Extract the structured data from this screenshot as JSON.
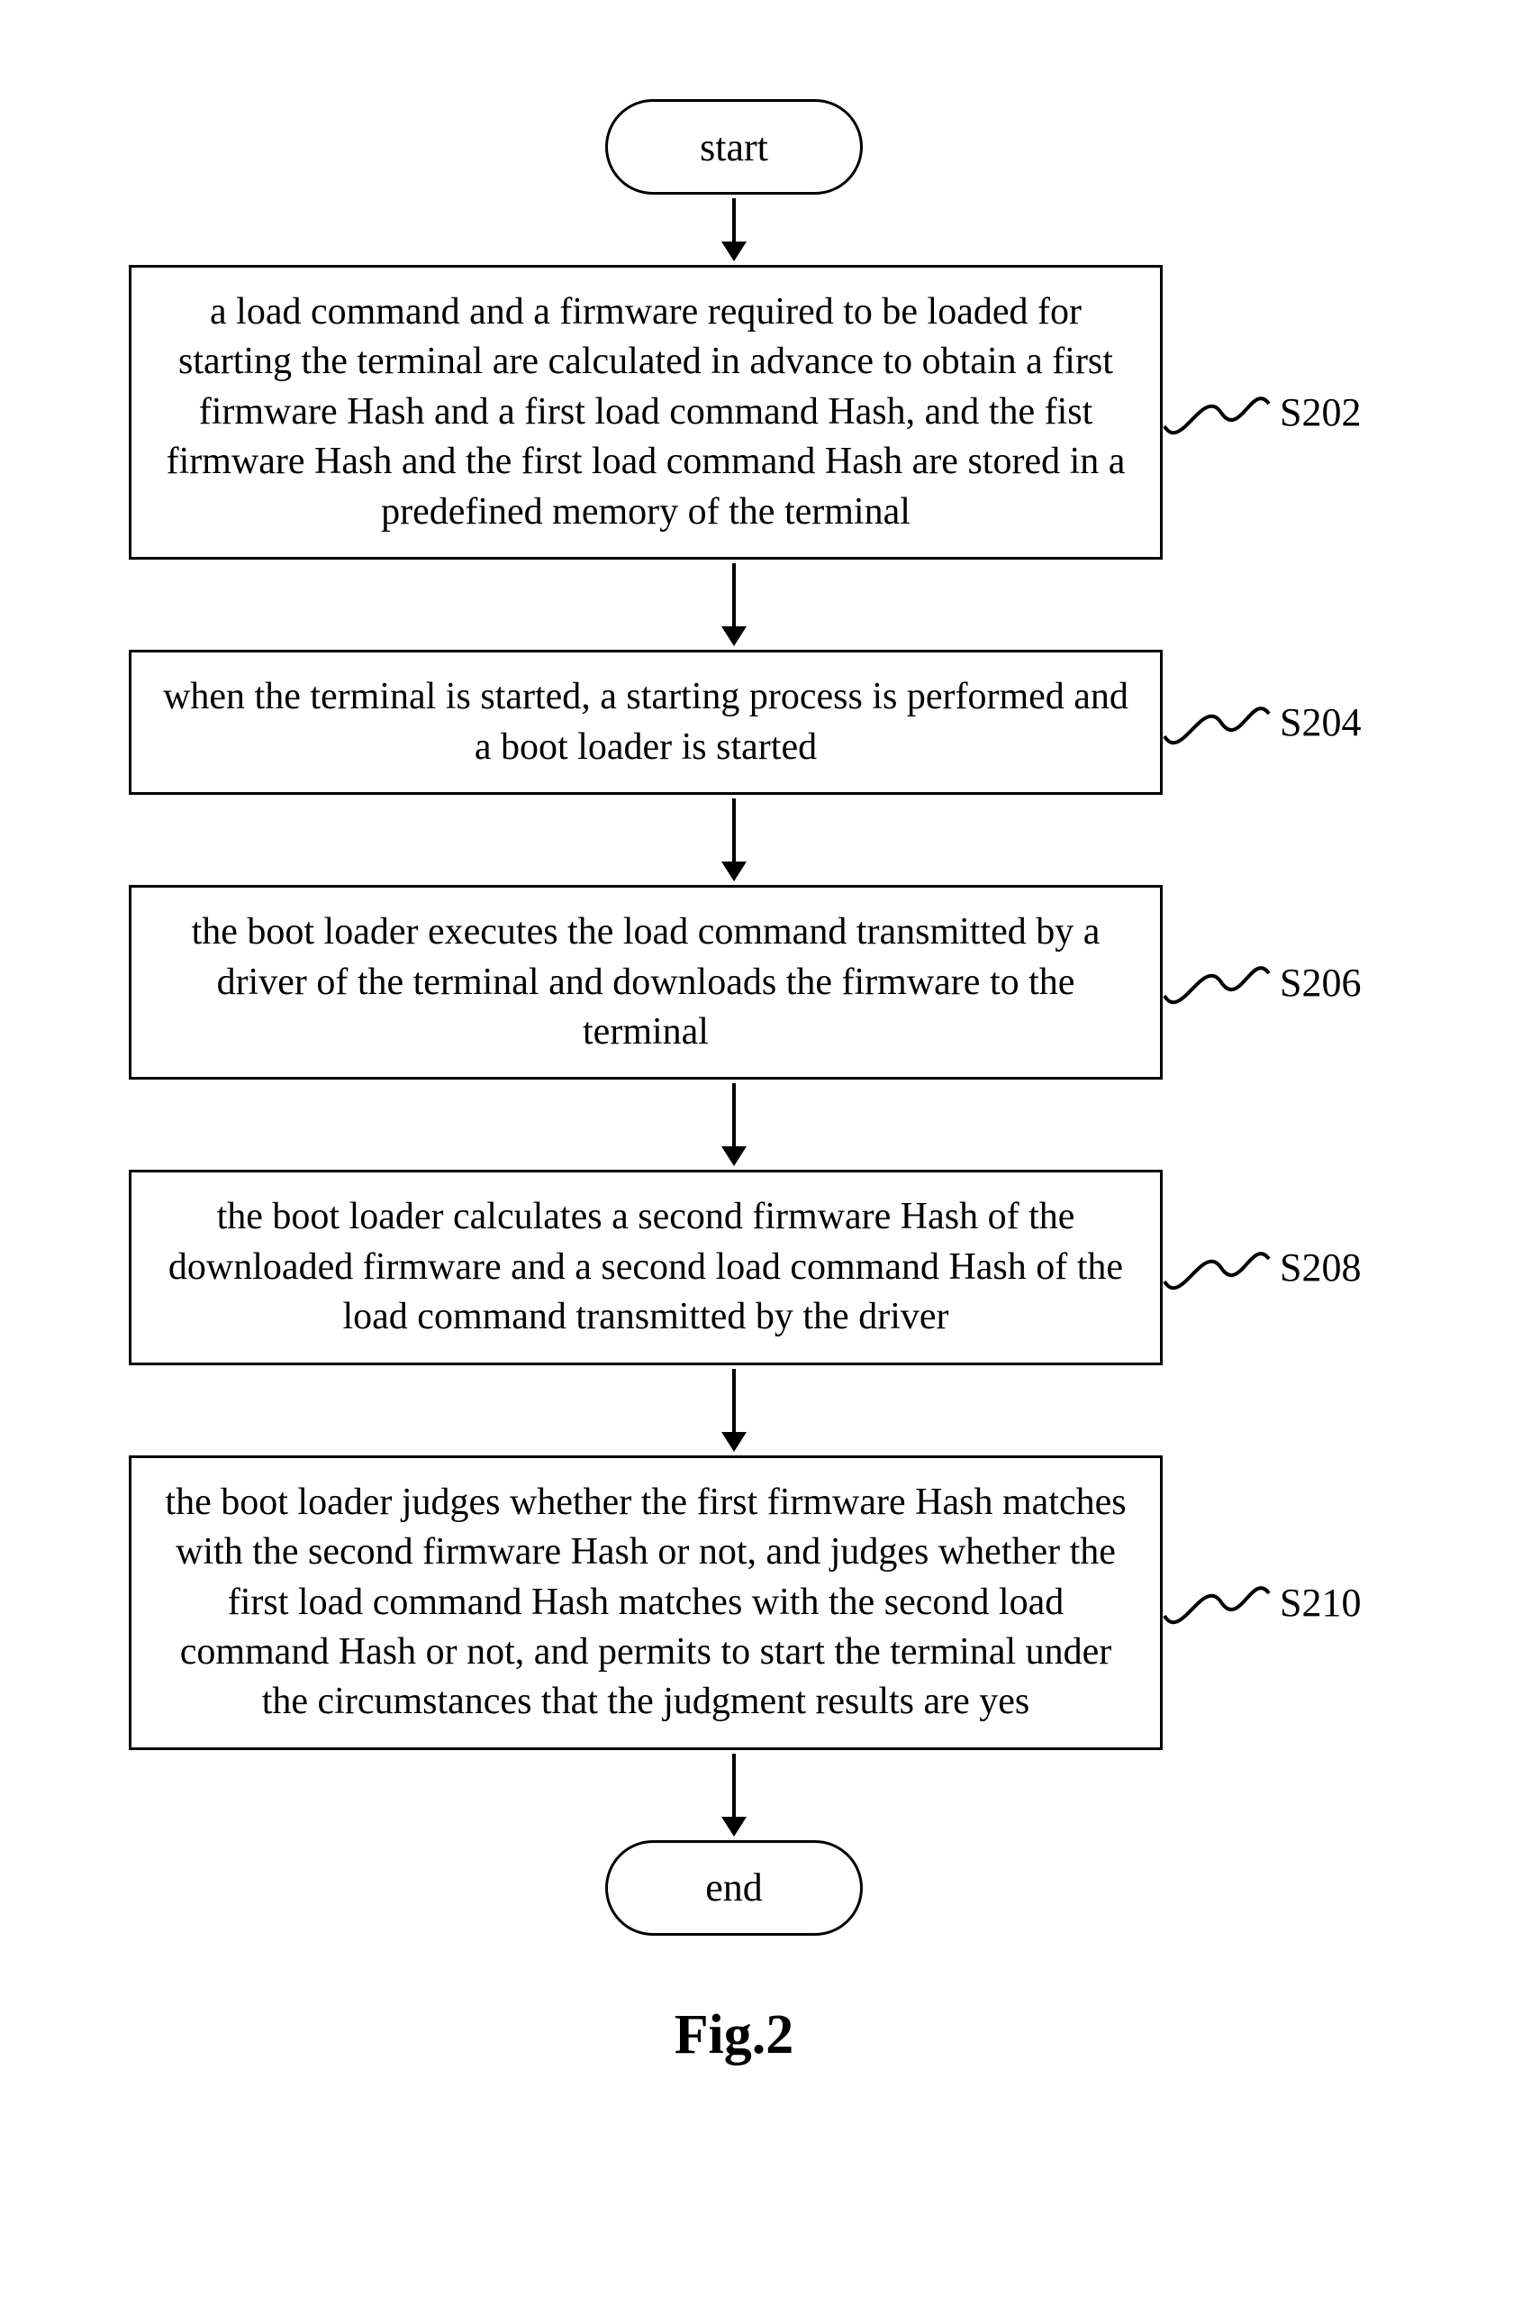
{
  "terminators": {
    "start": "start",
    "end": "end"
  },
  "steps": {
    "s202": {
      "text": "a load command and a firmware required to be loaded for starting the terminal are calculated in advance to obtain a first firmware Hash and a first load command Hash, and the fist firmware Hash and the first load command Hash are stored in a predefined memory of the terminal",
      "label": "S202"
    },
    "s204": {
      "text": "when the terminal is started, a starting process is performed and a boot loader is started",
      "label": "S204"
    },
    "s206": {
      "text": "the boot loader executes the load command transmitted by a driver of the terminal and downloads the firmware to the terminal",
      "label": "S206"
    },
    "s208": {
      "text": "the boot loader calculates a second firmware Hash of the downloaded firmware and a second load command Hash of the load command transmitted by the driver",
      "label": "S208"
    },
    "s210": {
      "text": "the boot loader judges whether the first firmware Hash matches with the second firmware Hash or not, and judges whether the first load command Hash matches with the second load command Hash or not, and permits to start the terminal under the circumstances that the judgment results are yes",
      "label": "S210"
    }
  },
  "caption": "Fig.2"
}
